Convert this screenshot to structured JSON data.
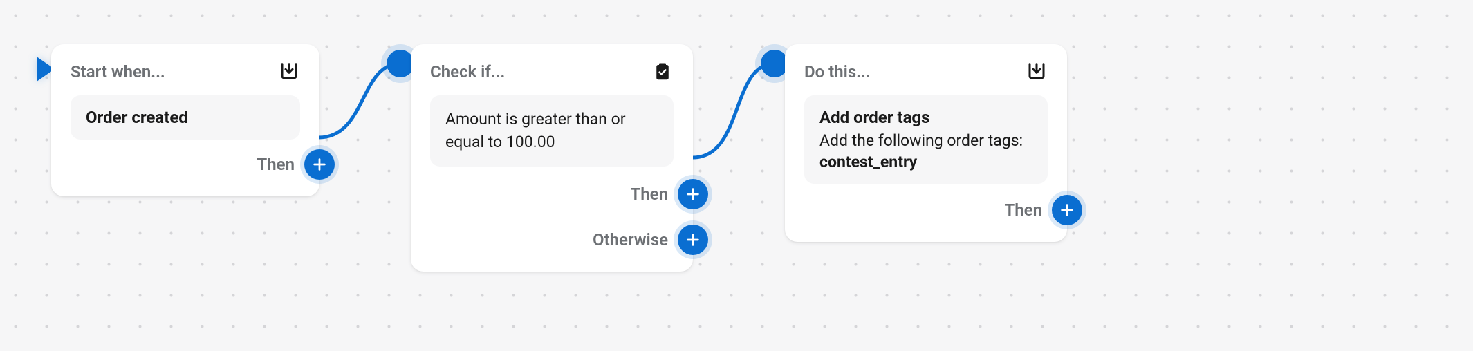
{
  "colors": {
    "accent": "#0a6ed1",
    "muted": "#6d7074"
  },
  "nodes": {
    "trigger": {
      "header": "Start when...",
      "content_title": "Order created",
      "then_label": "Then"
    },
    "condition": {
      "header": "Check if...",
      "content_body": "Amount is greater than or equal to 100.00",
      "then_label": "Then",
      "otherwise_label": "Otherwise"
    },
    "action": {
      "header": "Do this...",
      "content_title": "Add order tags",
      "content_sub": "Add the following order tags:",
      "content_tag": "contest_entry",
      "then_label": "Then"
    }
  },
  "icons": {
    "download": "download-icon",
    "clipboard": "clipboard-check-icon",
    "plus": "plus-icon"
  }
}
